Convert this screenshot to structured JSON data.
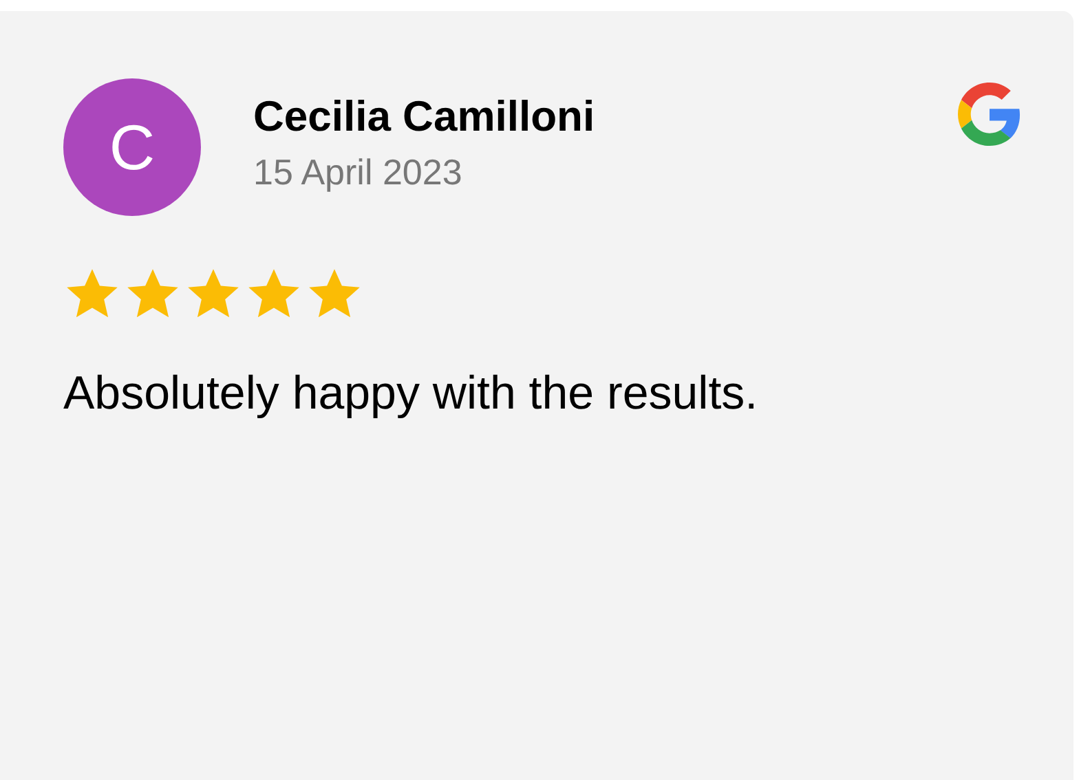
{
  "review": {
    "avatar_letter": "C",
    "color": "#ab47bc",
    "name": "Cecilia Camilloni",
    "date": "15 April 2023",
    "stars": 5,
    "text": "Absolutely happy with the results."
  }
}
